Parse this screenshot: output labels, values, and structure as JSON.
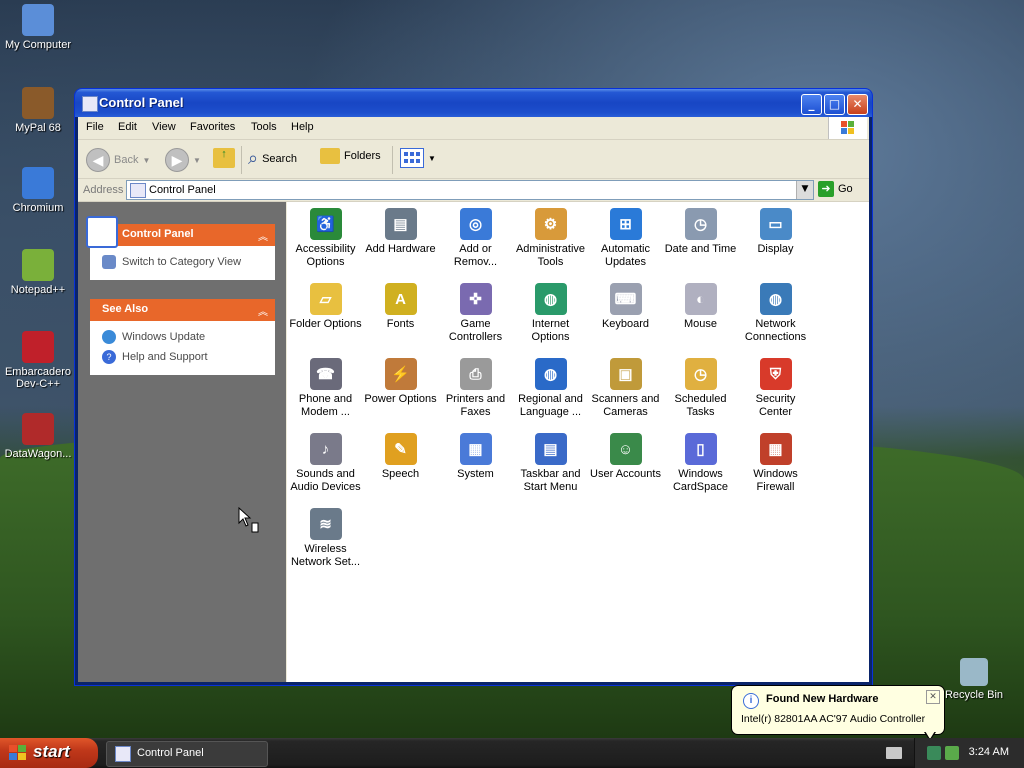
{
  "desktop": {
    "icons": [
      {
        "label": "My Computer",
        "color": "#5b8ed8"
      },
      {
        "label": "MyPal 68",
        "color": "#8a5a2a"
      },
      {
        "label": "Chromium",
        "color": "#3a7ad8"
      },
      {
        "label": "Notepad++",
        "color": "#7ab03a"
      },
      {
        "label": "Embarcadero Dev-C++",
        "color": "#c0202a"
      },
      {
        "label": "DataWagon...",
        "color": "#b02a2a"
      }
    ],
    "recycle_bin": "Recycle Bin"
  },
  "window": {
    "title": "Control Panel",
    "buttons": {
      "minimize": "_",
      "maximize": "□",
      "close": "✕"
    },
    "menu": [
      "File",
      "Edit",
      "View",
      "Favorites",
      "Tools",
      "Help"
    ],
    "toolbar": {
      "back": "Back",
      "search": "Search",
      "folders": "Folders"
    },
    "address": {
      "label": "Address",
      "value": "Control Panel",
      "go": "Go"
    }
  },
  "taskpane": {
    "control_panel": {
      "title": "Control Panel",
      "links": [
        "Switch to Category View"
      ]
    },
    "see_also": {
      "title": "See Also",
      "links": [
        "Windows Update",
        "Help and Support"
      ]
    }
  },
  "items": [
    {
      "l1": "Accessibility",
      "l2": "Options",
      "color": "#2a8a3a",
      "glyph": "♿"
    },
    {
      "l1": "Add Hardware",
      "l2": "",
      "color": "#6a7a8a",
      "glyph": "▤"
    },
    {
      "l1": "Add or",
      "l2": "Remov...",
      "color": "#3a7ad8",
      "glyph": "◎"
    },
    {
      "l1": "Administrative",
      "l2": "Tools",
      "color": "#d89a3a",
      "glyph": "⚙"
    },
    {
      "l1": "Automatic",
      "l2": "Updates",
      "color": "#2a7ad8",
      "glyph": "⊞"
    },
    {
      "l1": "Date and Time",
      "l2": "",
      "color": "#8a9ab0",
      "glyph": "◷"
    },
    {
      "l1": "Display",
      "l2": "",
      "color": "#4a8ac8",
      "glyph": "▭"
    },
    {
      "l1": "Folder Options",
      "l2": "",
      "color": "#e8c040",
      "glyph": "▱"
    },
    {
      "l1": "Fonts",
      "l2": "",
      "color": "#d0b020",
      "glyph": "A"
    },
    {
      "l1": "Game",
      "l2": "Controllers",
      "color": "#7a6ab0",
      "glyph": "✜"
    },
    {
      "l1": "Internet",
      "l2": "Options",
      "color": "#2a9a6a",
      "glyph": "◍"
    },
    {
      "l1": "Keyboard",
      "l2": "",
      "color": "#9aa0b0",
      "glyph": "⌨"
    },
    {
      "l1": "Mouse",
      "l2": "",
      "color": "#b0b0c0",
      "glyph": "◐"
    },
    {
      "l1": "Network",
      "l2": "Connections",
      "color": "#3a7ab8",
      "glyph": "◍"
    },
    {
      "l1": "Phone and",
      "l2": "Modem ...",
      "color": "#6a6a7a",
      "glyph": "☎"
    },
    {
      "l1": "Power Options",
      "l2": "",
      "color": "#c07a3a",
      "glyph": "⚡"
    },
    {
      "l1": "Printers and",
      "l2": "Faxes",
      "color": "#9a9a9a",
      "glyph": "⎙"
    },
    {
      "l1": "Regional and",
      "l2": "Language ...",
      "color": "#2a6ac8",
      "glyph": "◍"
    },
    {
      "l1": "Scanners and",
      "l2": "Cameras",
      "color": "#c09a3a",
      "glyph": "▣"
    },
    {
      "l1": "Scheduled",
      "l2": "Tasks",
      "color": "#e0b040",
      "glyph": "◷"
    },
    {
      "l1": "Security",
      "l2": "Center",
      "color": "#d83a2a",
      "glyph": "⛨"
    },
    {
      "l1": "Sounds and",
      "l2": "Audio Devices",
      "color": "#7a7a8a",
      "glyph": "♪"
    },
    {
      "l1": "Speech",
      "l2": "",
      "color": "#e0a020",
      "glyph": "✎"
    },
    {
      "l1": "System",
      "l2": "",
      "color": "#4a7ad8",
      "glyph": "▦"
    },
    {
      "l1": "Taskbar and",
      "l2": "Start Menu",
      "color": "#3a6ac8",
      "glyph": "▤"
    },
    {
      "l1": "User Accounts",
      "l2": "",
      "color": "#3a8a4a",
      "glyph": "☺"
    },
    {
      "l1": "Windows",
      "l2": "CardSpace",
      "color": "#5a6ad8",
      "glyph": "▯"
    },
    {
      "l1": "Windows",
      "l2": "Firewall",
      "color": "#c0402a",
      "glyph": "▦"
    },
    {
      "l1": "Wireless",
      "l2": "Network Set...",
      "color": "#6a7a8a",
      "glyph": "≋"
    }
  ],
  "taskbar": {
    "start": "start",
    "task": "Control Panel",
    "clock": "3:24 AM"
  },
  "balloon": {
    "title": "Found New Hardware",
    "text": "Intel(r) 82801AA AC'97 Audio Controller"
  }
}
